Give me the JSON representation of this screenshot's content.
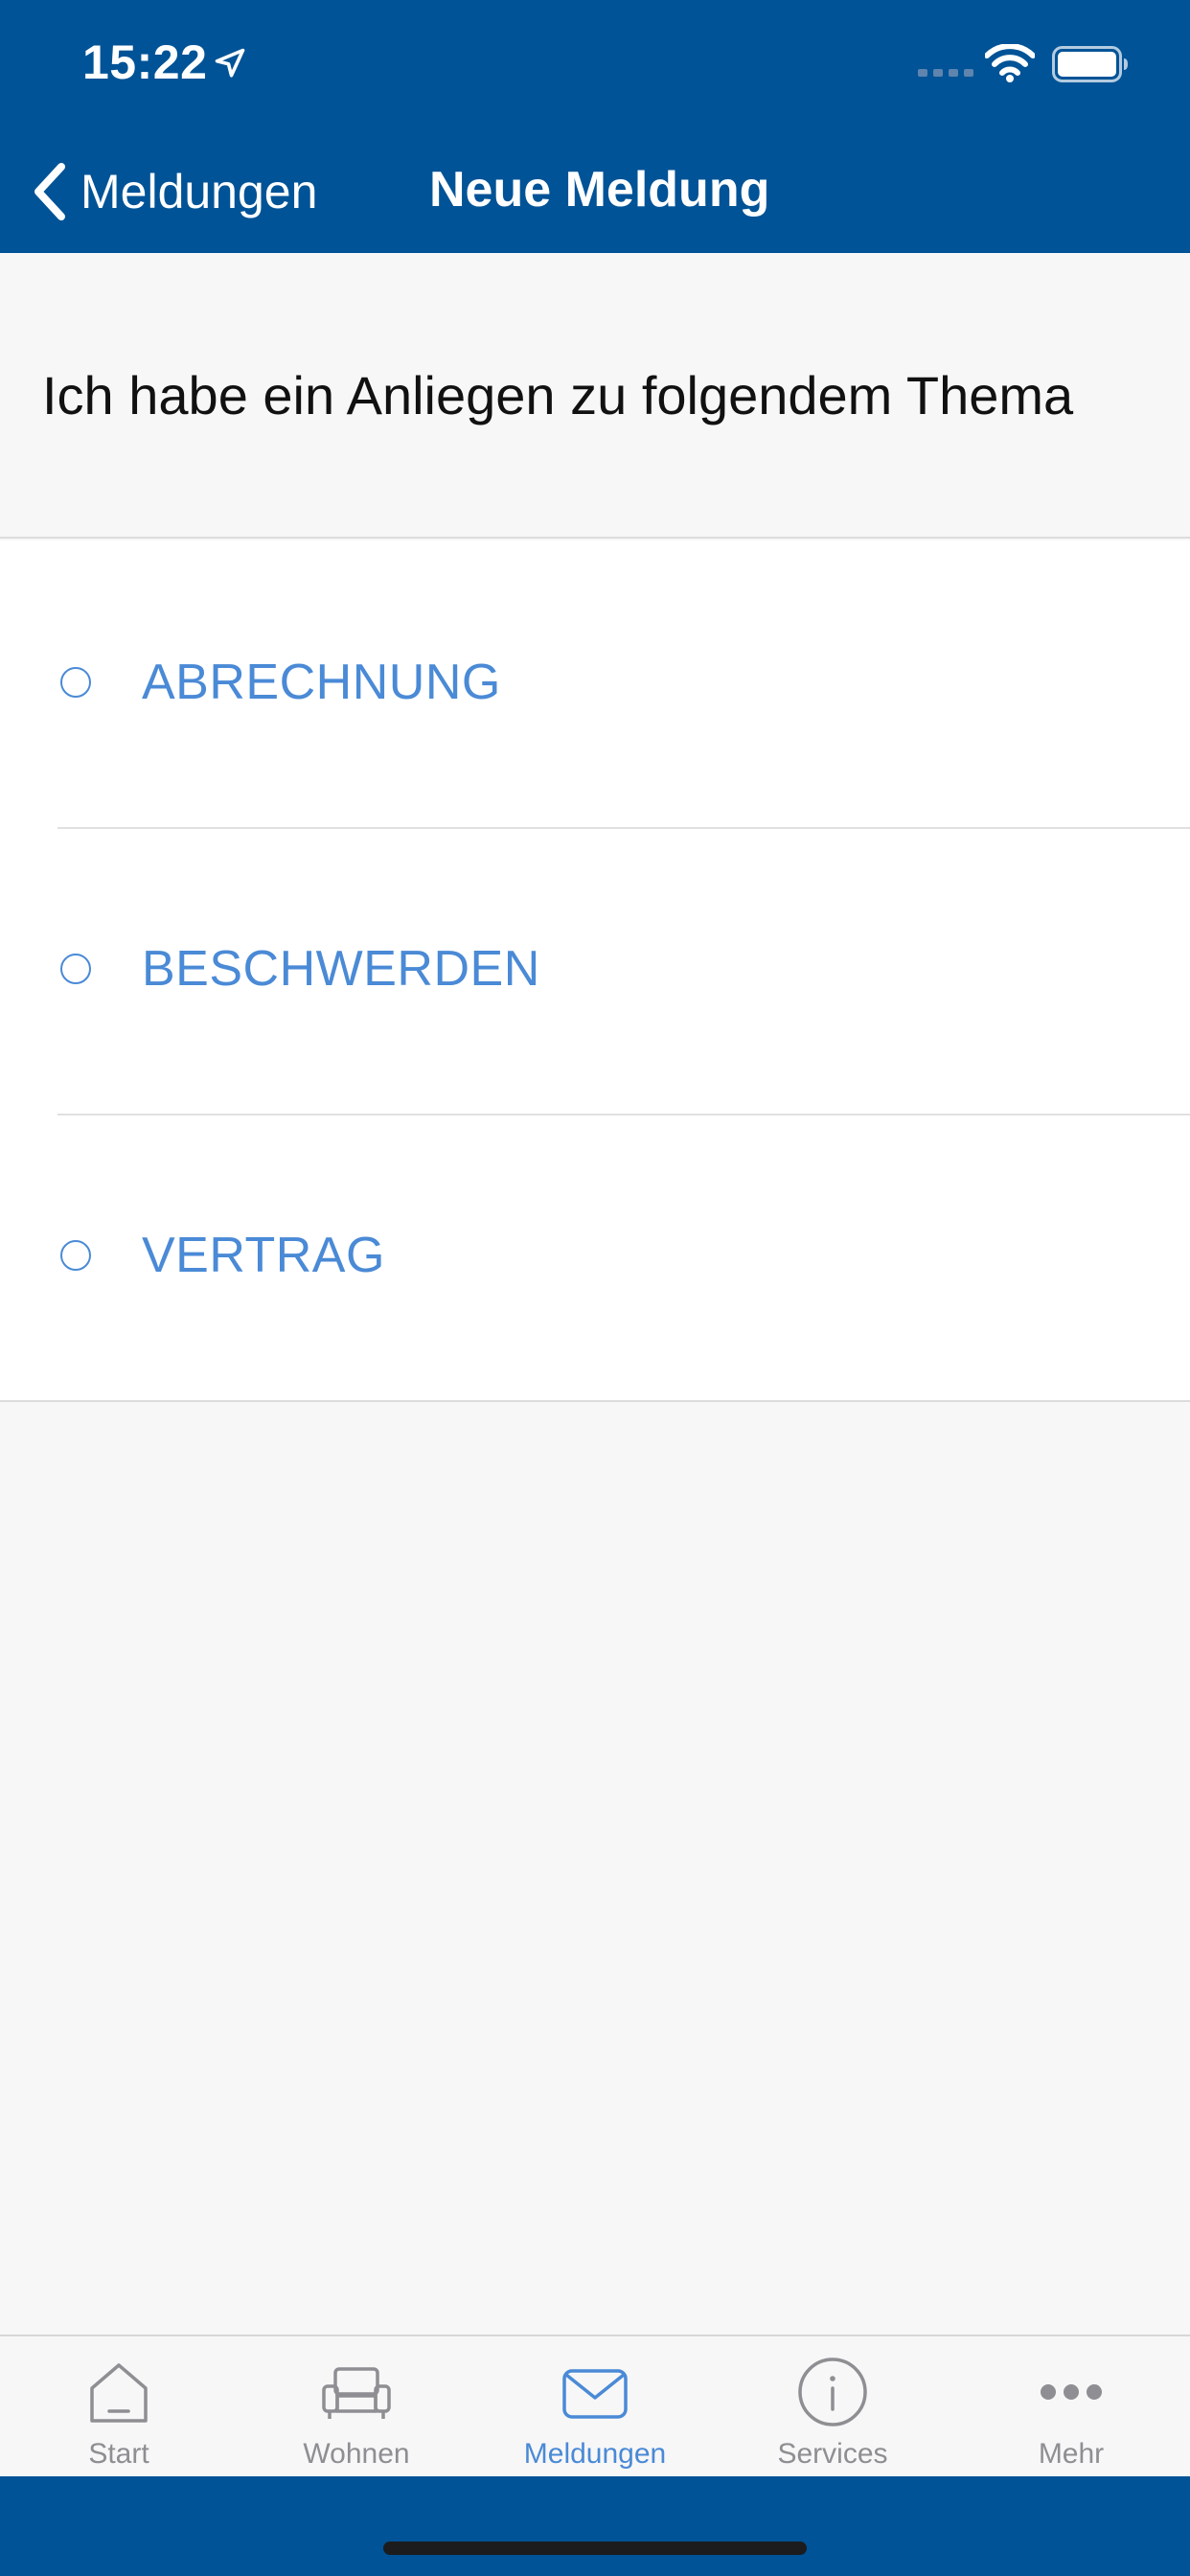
{
  "status_bar": {
    "time": "15:22",
    "location_icon": "location-arrow-icon",
    "signal_icon": "cellular-signal-icon",
    "wifi_icon": "wifi-icon",
    "battery_icon": "battery-icon"
  },
  "nav_bar": {
    "back_label": "Meldungen",
    "title": "Neue Meldung",
    "background_color": "#005397"
  },
  "prompt": {
    "text": "Ich habe ein Anliegen zu folgendem Thema"
  },
  "options": [
    {
      "label": "ABRECHNUNG",
      "selected": false
    },
    {
      "label": "BESCHWERDEN",
      "selected": false
    },
    {
      "label": "VERTRAG",
      "selected": false
    }
  ],
  "tab_bar": {
    "active_color": "#4a8ad6",
    "inactive_color": "#8e8e93",
    "tabs": [
      {
        "label": "Start",
        "icon": "home-icon",
        "active": false
      },
      {
        "label": "Wohnen",
        "icon": "sofa-icon",
        "active": false
      },
      {
        "label": "Meldungen",
        "icon": "envelope-icon",
        "active": true
      },
      {
        "label": "Services",
        "icon": "info-icon",
        "active": false
      },
      {
        "label": "Mehr",
        "icon": "more-dots-icon",
        "active": false
      }
    ]
  }
}
